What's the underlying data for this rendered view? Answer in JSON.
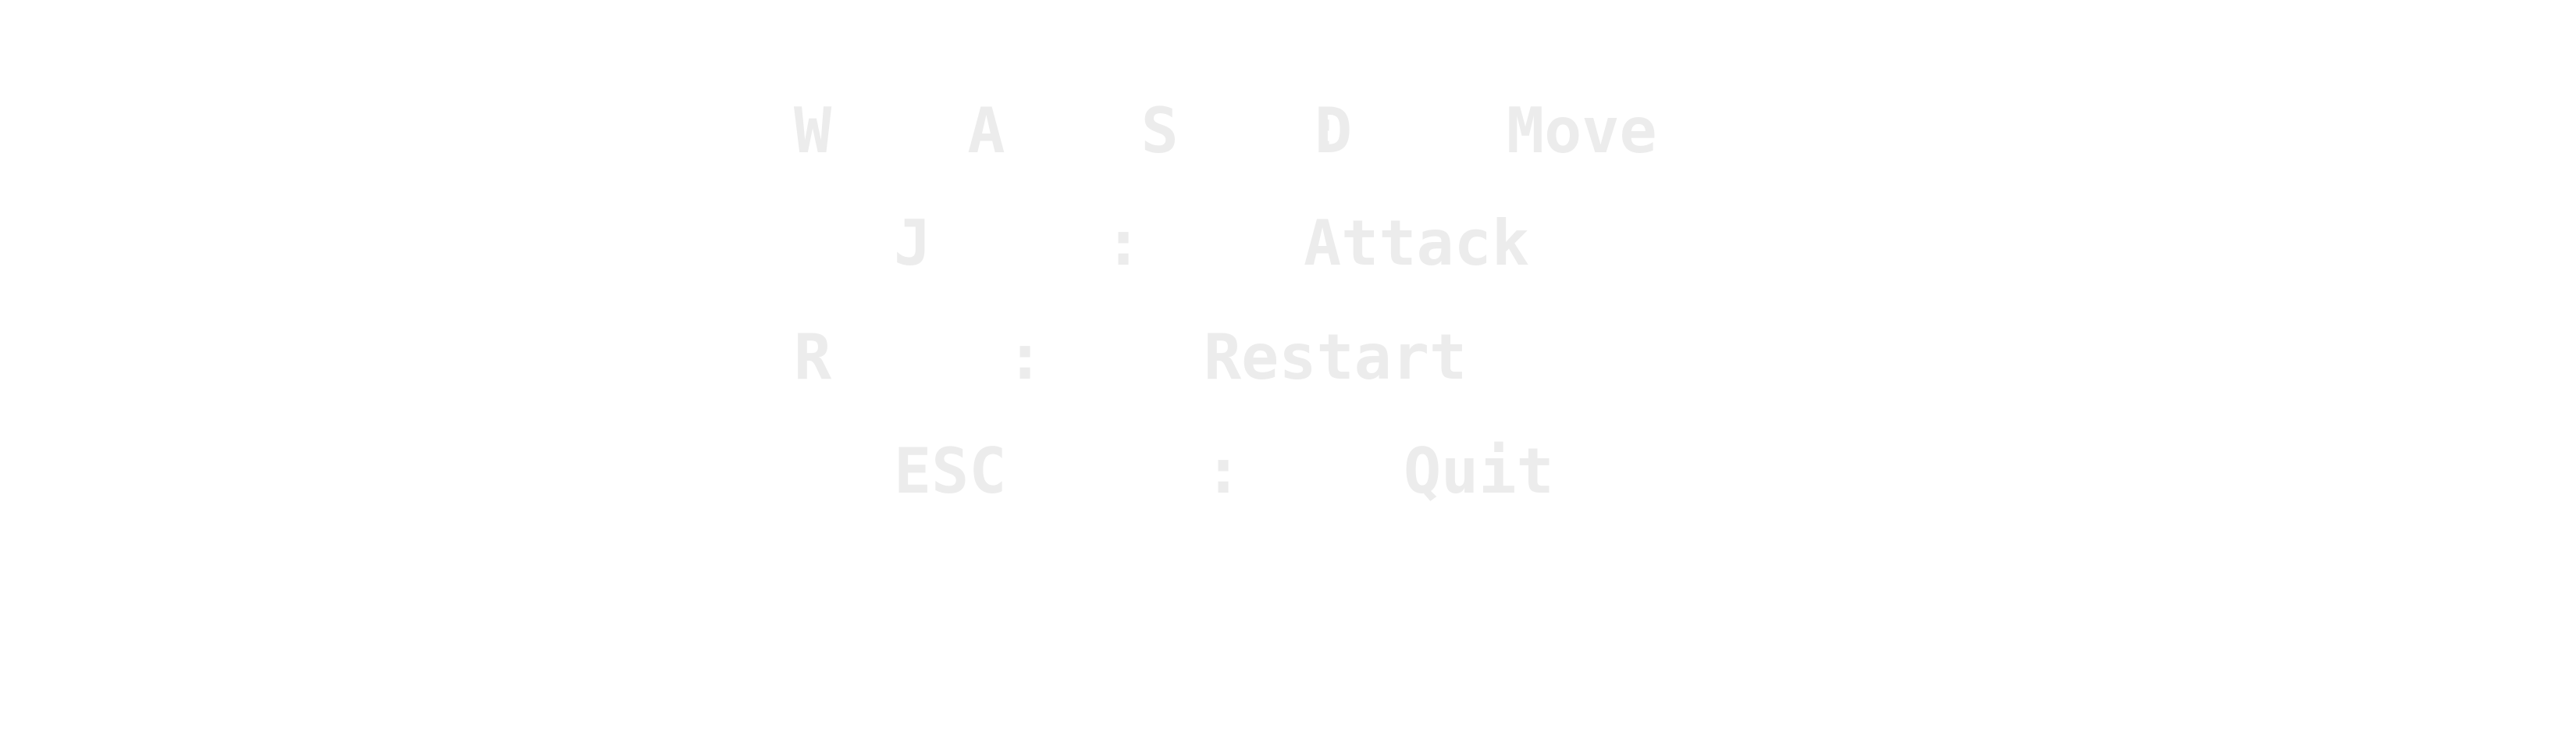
{
  "controls": [
    {
      "keys": "W A S D",
      "separator": ":",
      "action": "Move"
    },
    {
      "keys": "J",
      "separator": ":",
      "action": "Attack"
    },
    {
      "keys": "R",
      "separator": ":",
      "action": "Restart"
    },
    {
      "keys": "ESC",
      "separator": ":",
      "action": "Quit"
    }
  ],
  "colors": {
    "background": "#ffffff",
    "text": "#ececec"
  }
}
